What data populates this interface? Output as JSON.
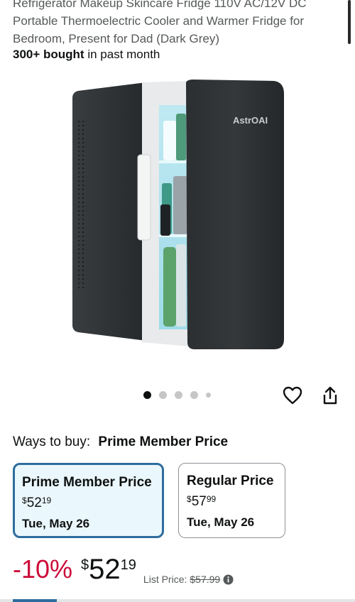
{
  "product": {
    "title_lines": [
      "Refrigerator Makeup Skincare Fridge 110V AC/12V DC",
      "Portable Thermoelectric Cooler and Warmer Fridge for",
      "Bedroom, Present for Dad (Dark Grey)"
    ],
    "bought_strong": "300+ bought",
    "bought_rest": " in past month",
    "image_alt": "AstroAI mini fridge, dark grey, door open",
    "brand_mark": "AstrOAI"
  },
  "carousel": {
    "total": 5,
    "active_index": 0
  },
  "actions": {
    "wishlist_icon": "heart-icon",
    "share_icon": "share-icon"
  },
  "ways_to_buy": {
    "label": "Ways to buy:",
    "selected": "Prime Member Price",
    "options": [
      {
        "title": "Prime Member Price",
        "currency": "$",
        "whole": "52",
        "fraction": "19",
        "date": "Tue, May 26",
        "selected": true
      },
      {
        "title": "Regular Price",
        "currency": "$",
        "whole": "57",
        "fraction": "99",
        "date": "Tue, May 26",
        "selected": false
      }
    ]
  },
  "price": {
    "discount": "-10%",
    "currency": "$",
    "whole": "52",
    "fraction": "19",
    "list_label": "List Price:",
    "list_value": "$57.99"
  },
  "colors": {
    "discount_red": "#cc0c39",
    "selected_border": "#2e6d9e",
    "selected_bg": "#eaf7fc"
  }
}
